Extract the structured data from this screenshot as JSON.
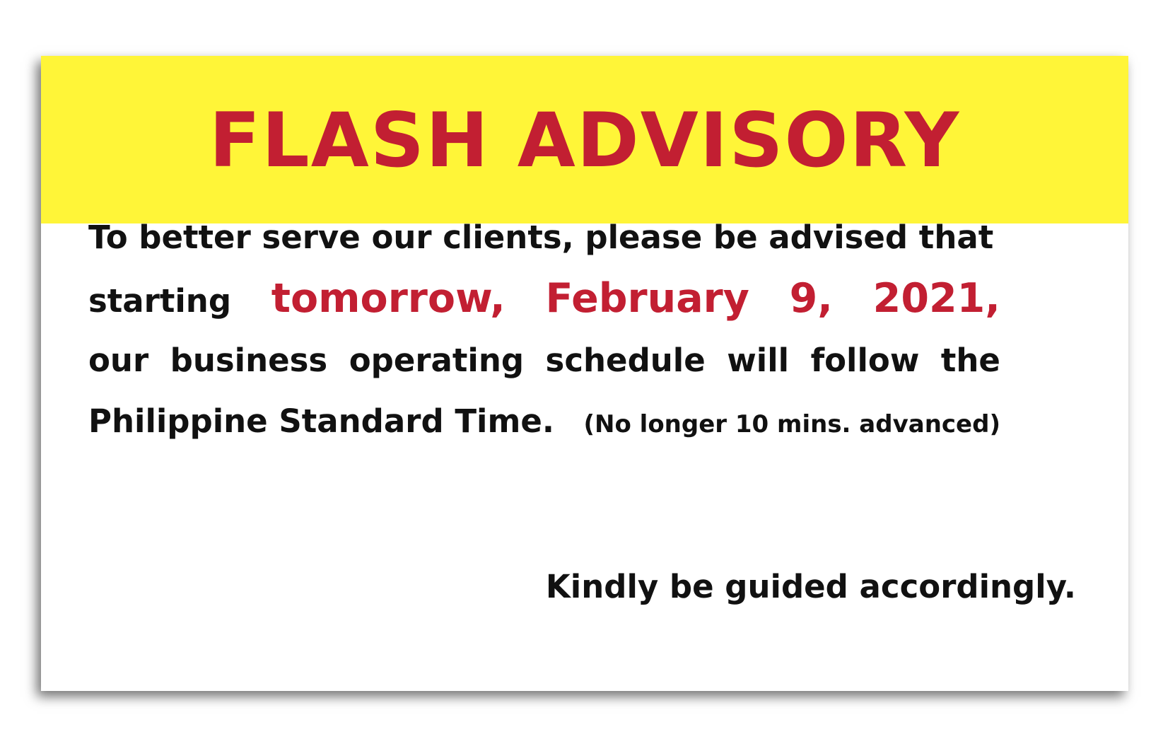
{
  "banner": {
    "title": "FLASH ADVISORY"
  },
  "advisory": {
    "line1": "To better serve our clients, please be advised that",
    "line2_prefix": "starting",
    "line2_highlight": [
      "tomorrow,",
      "February",
      "9,",
      "2021,"
    ],
    "line3_words": [
      "our",
      "business",
      "operating",
      "schedule",
      "will",
      "follow",
      "the"
    ],
    "line4_main": "Philippine Standard Time.",
    "line4_note": "(No longer 10 mins. advanced)",
    "closing": "Kindly be guided accordingly."
  },
  "colors": {
    "banner_background": "#fff538",
    "title_red": "#c21f32",
    "body_text": "#111111",
    "page_background": "#ffffff"
  }
}
